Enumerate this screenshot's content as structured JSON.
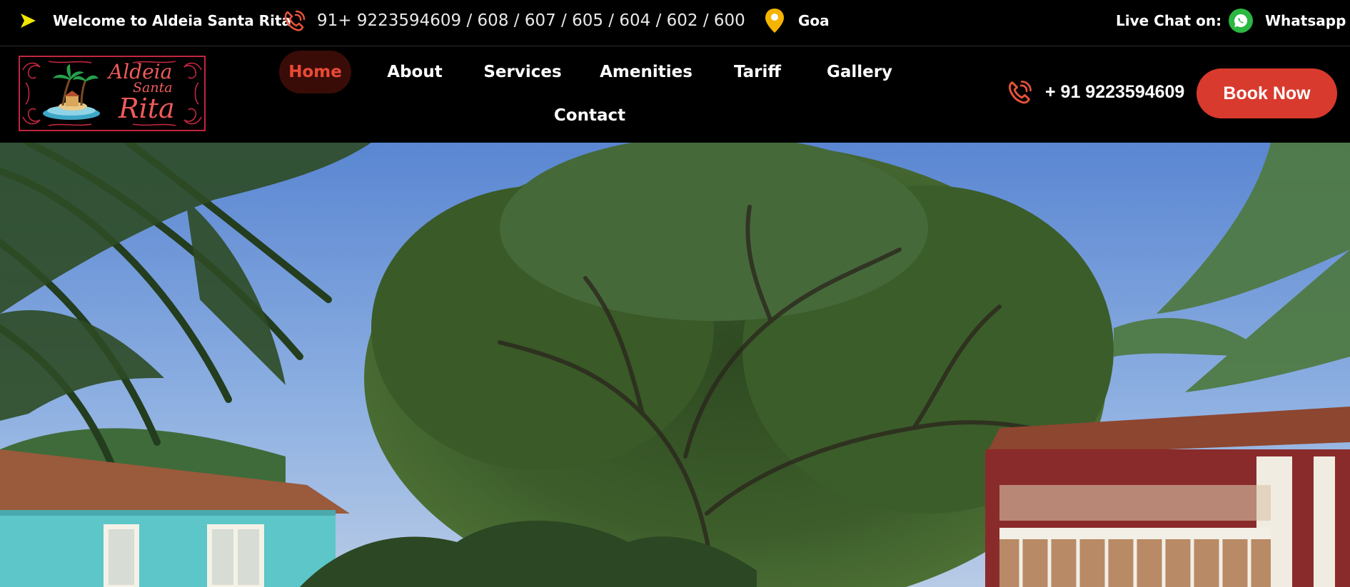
{
  "topbar": {
    "welcome": "Welcome to Aldeia Santa Rita",
    "phones": "91+ 9223594609 / 608 / 607 / 605 / 604 / 602 / 600",
    "location": "Goa",
    "live_chat_label": "Live Chat on:",
    "whatsapp_label": "Whatsapp"
  },
  "logo": {
    "line1": "Aldeia",
    "line2": "Santa",
    "line3": "Rita"
  },
  "nav": {
    "items": [
      {
        "label": "Home",
        "active": true
      },
      {
        "label": "About"
      },
      {
        "label": "Services"
      },
      {
        "label": "Amenities"
      },
      {
        "label": "Tariff"
      },
      {
        "label": "Gallery"
      },
      {
        "label": "Contact"
      }
    ]
  },
  "header": {
    "phone": "+ 91 9223594609",
    "book_label": "Book Now"
  },
  "colors": {
    "accent": "#d83a2d",
    "nav_active_text": "#ea4a35",
    "icon_orange": "#e8533a",
    "pin_yellow": "#f4b400",
    "arrow_yellow": "#f2e600",
    "whatsapp_green": "#2bb741"
  },
  "icons": [
    "arrow-icon",
    "phone-icon",
    "location-pin-icon",
    "whatsapp-icon"
  ]
}
